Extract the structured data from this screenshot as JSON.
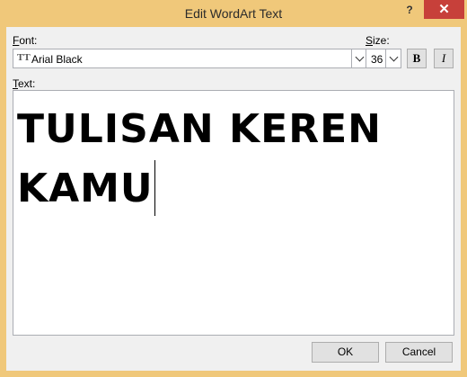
{
  "window": {
    "title": "Edit WordArt Text",
    "help_label": "?",
    "close_label": "✕"
  },
  "font": {
    "label_accel": "F",
    "label_rest": "ont:",
    "value": "Arial Black"
  },
  "size": {
    "label_accel": "S",
    "label_rest": "ize:",
    "value": "36"
  },
  "format": {
    "bold_label": "B",
    "italic_label": "I"
  },
  "text": {
    "label_accel": "T",
    "label_rest": "ext:",
    "value": "TULISAN KEREN\nKAMU"
  },
  "buttons": {
    "ok": "OK",
    "cancel": "Cancel"
  },
  "colors": {
    "frame": "#f0c87a",
    "close_button": "#c7403a",
    "client": "#f0f0f0"
  }
}
